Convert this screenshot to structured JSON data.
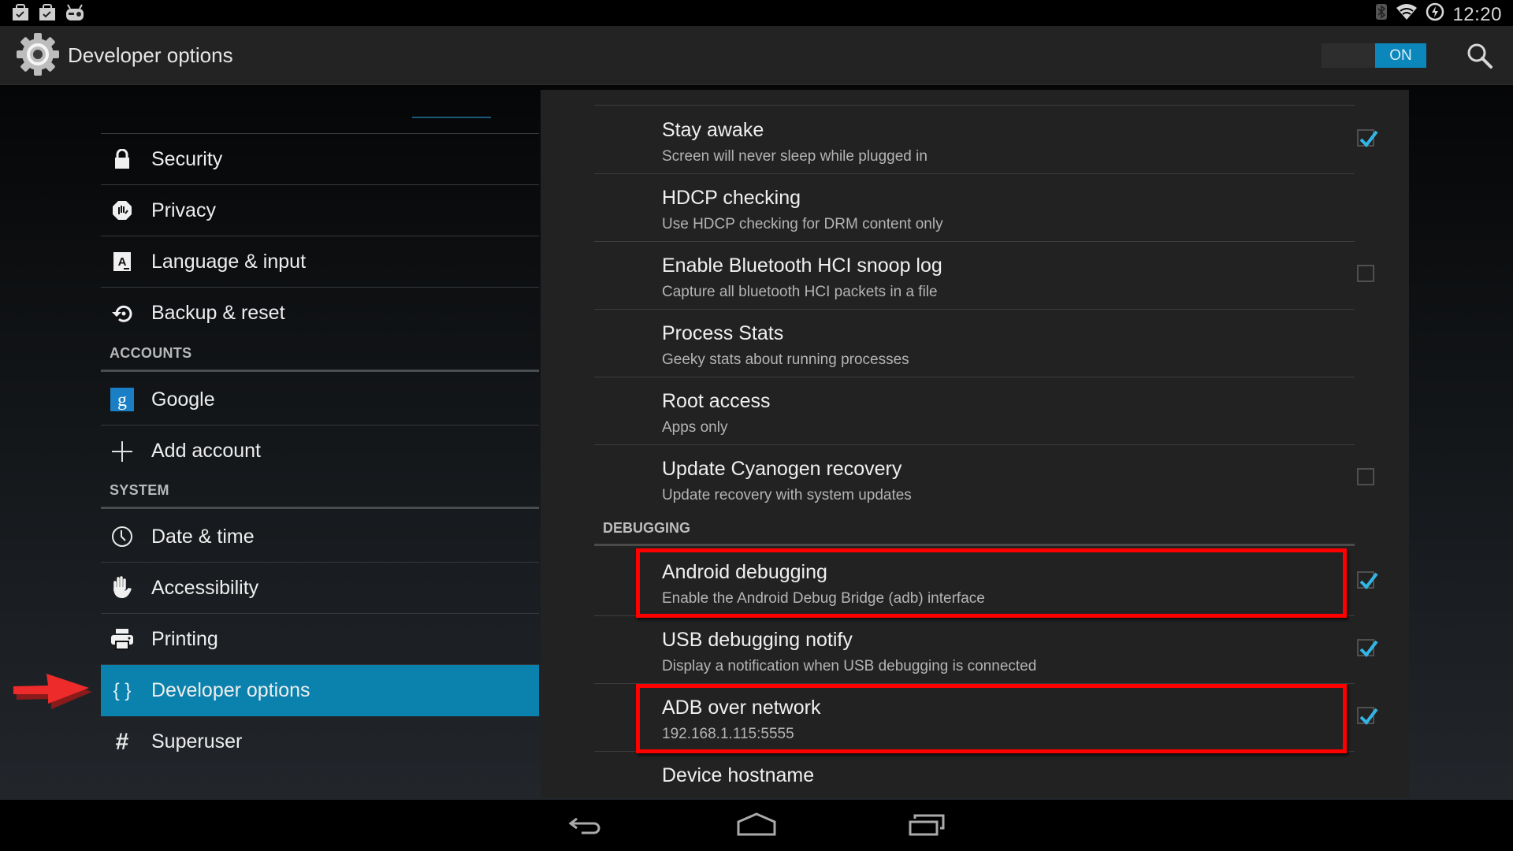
{
  "status_bar": {
    "notification_icons": [
      "play-store-update-icon",
      "play-store-update-icon",
      "cyanogenmod-icon"
    ],
    "system_icons": [
      "bluetooth-icon",
      "wifi-icon",
      "battery-charging-icon"
    ],
    "time": "12:20"
  },
  "action_bar": {
    "title": "Developer options",
    "master_switch": {
      "state": "ON",
      "on": true
    },
    "search_icon": "search-icon"
  },
  "sidebar": {
    "items_top": [
      {
        "label": "Security",
        "icon": "lock-icon"
      },
      {
        "label": "Privacy",
        "icon": "privacy-hand-icon"
      },
      {
        "label": "Language & input",
        "icon": "keyboard-a-icon"
      },
      {
        "label": "Backup & reset",
        "icon": "restore-icon"
      }
    ],
    "accounts_header": "ACCOUNTS",
    "accounts": [
      {
        "label": "Google",
        "icon": "google-icon"
      },
      {
        "label": "Add account",
        "icon": "plus-icon"
      }
    ],
    "system_header": "SYSTEM",
    "system": [
      {
        "label": "Date & time",
        "icon": "clock-icon"
      },
      {
        "label": "Accessibility",
        "icon": "hand-icon"
      },
      {
        "label": "Printing",
        "icon": "printer-icon"
      },
      {
        "label": "Developer options",
        "icon": "braces-icon",
        "active": true
      },
      {
        "label": "Superuser",
        "icon": "hash-icon"
      }
    ],
    "accent_color": "#0b82ad"
  },
  "content": {
    "rows": [
      {
        "title": "Stay awake",
        "summary": "Screen will never sleep while plugged in",
        "checkbox": true,
        "checked": true
      },
      {
        "title": "HDCP checking",
        "summary": "Use HDCP checking for DRM content only",
        "checkbox": false
      },
      {
        "title": "Enable Bluetooth HCI snoop log",
        "summary": "Capture all bluetooth HCI packets in a file",
        "checkbox": true,
        "checked": false
      },
      {
        "title": "Process Stats",
        "summary": "Geeky stats about running processes",
        "checkbox": false
      },
      {
        "title": "Root access",
        "summary": "Apps only",
        "checkbox": false
      },
      {
        "title": "Update Cyanogen recovery",
        "summary": "Update recovery with system updates",
        "checkbox": true,
        "checked": false
      }
    ],
    "debugging_header": "DEBUGGING",
    "debug_rows": [
      {
        "title": "Android debugging",
        "summary": "Enable the Android Debug Bridge (adb) interface",
        "checkbox": true,
        "checked": true,
        "highlighted": true
      },
      {
        "title": "USB debugging notify",
        "summary": "Display a notification when USB debugging is connected",
        "checkbox": true,
        "checked": true
      },
      {
        "title": "ADB over network",
        "summary": "192.168.1.115:5555",
        "checkbox": true,
        "checked": true,
        "highlighted": true
      },
      {
        "title": "Device hostname",
        "summary": "",
        "checkbox": false
      }
    ],
    "highlight_color": "#ff0000",
    "check_color": "#33b5e5"
  },
  "nav_bar": {
    "buttons": [
      "back-icon",
      "home-icon",
      "recent-apps-icon"
    ]
  }
}
